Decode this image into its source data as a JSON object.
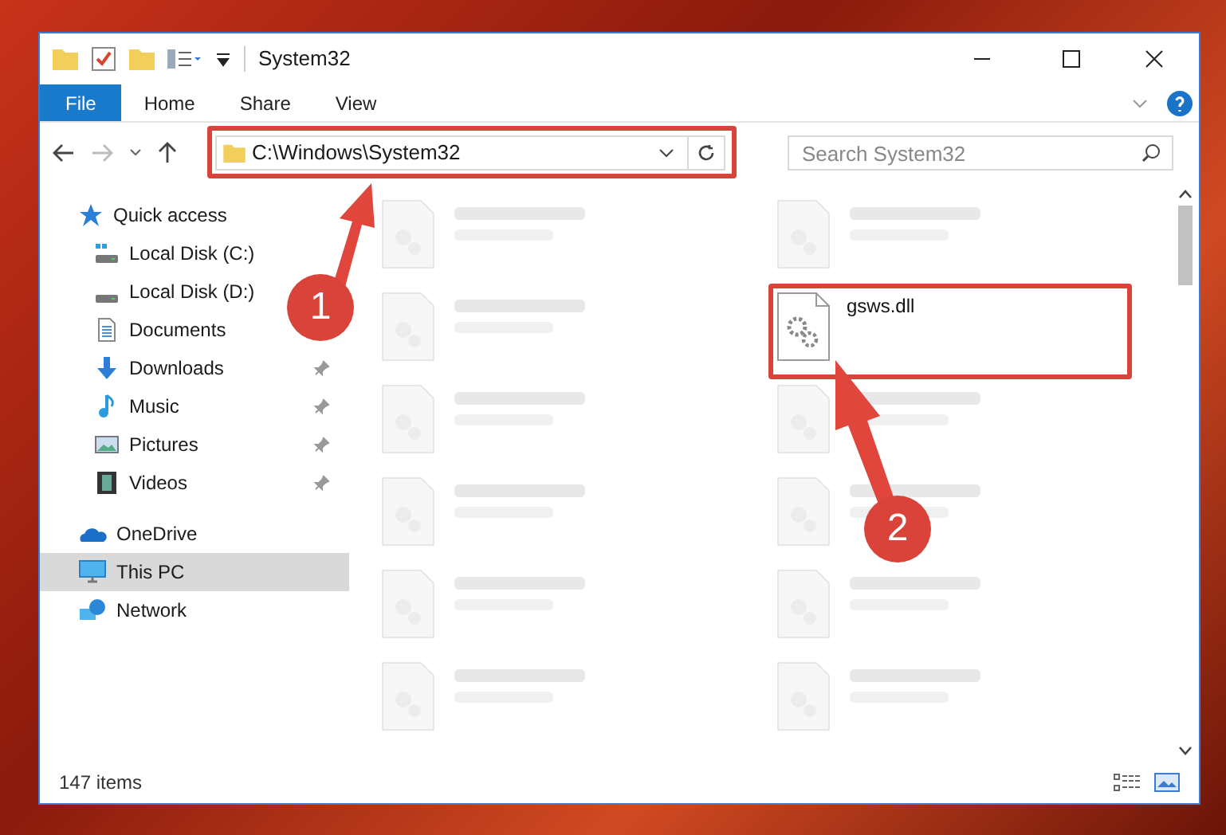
{
  "window": {
    "title": "System32"
  },
  "ribbon_tabs": [
    {
      "label": "File",
      "selected": true
    },
    {
      "label": "Home",
      "selected": false
    },
    {
      "label": "Share",
      "selected": false
    },
    {
      "label": "View",
      "selected": false
    }
  ],
  "address": {
    "path": "C:\\Windows\\System32"
  },
  "search": {
    "placeholder": "Search System32"
  },
  "sidebar": {
    "items": [
      {
        "label": "Quick access",
        "kind": "quick",
        "pinned": false,
        "selected": false
      },
      {
        "label": "Local Disk (C:)",
        "kind": "diskc",
        "pinned": false,
        "selected": false
      },
      {
        "label": "Local Disk (D:)",
        "kind": "disk",
        "pinned": false,
        "selected": false
      },
      {
        "label": "Documents",
        "kind": "docs",
        "pinned": false,
        "selected": false
      },
      {
        "label": "Downloads",
        "kind": "down",
        "pinned": true,
        "selected": false
      },
      {
        "label": "Music",
        "kind": "music",
        "pinned": true,
        "selected": false
      },
      {
        "label": "Pictures",
        "kind": "pics",
        "pinned": true,
        "selected": false
      },
      {
        "label": "Videos",
        "kind": "video",
        "pinned": true,
        "selected": false
      },
      {
        "label": "OneDrive",
        "kind": "cloud",
        "pinned": false,
        "selected": false
      },
      {
        "label": "This PC",
        "kind": "pc",
        "pinned": false,
        "selected": true
      },
      {
        "label": "Network",
        "kind": "net",
        "pinned": false,
        "selected": false
      }
    ]
  },
  "files": [
    {
      "kind": "blurred"
    },
    {
      "kind": "blurred"
    },
    {
      "kind": "blurred"
    },
    {
      "name": "gsws.dll",
      "kind": "highlighted"
    },
    {
      "kind": "blurred"
    },
    {
      "kind": "blurred"
    },
    {
      "kind": "blurred"
    },
    {
      "kind": "blurred"
    },
    {
      "kind": "blurred"
    },
    {
      "kind": "blurred"
    },
    {
      "kind": "blurred"
    },
    {
      "kind": "blurred"
    }
  ],
  "status_bar": {
    "count": "147 items"
  },
  "annotations": [
    {
      "number": "1"
    },
    {
      "number": "2"
    }
  ]
}
